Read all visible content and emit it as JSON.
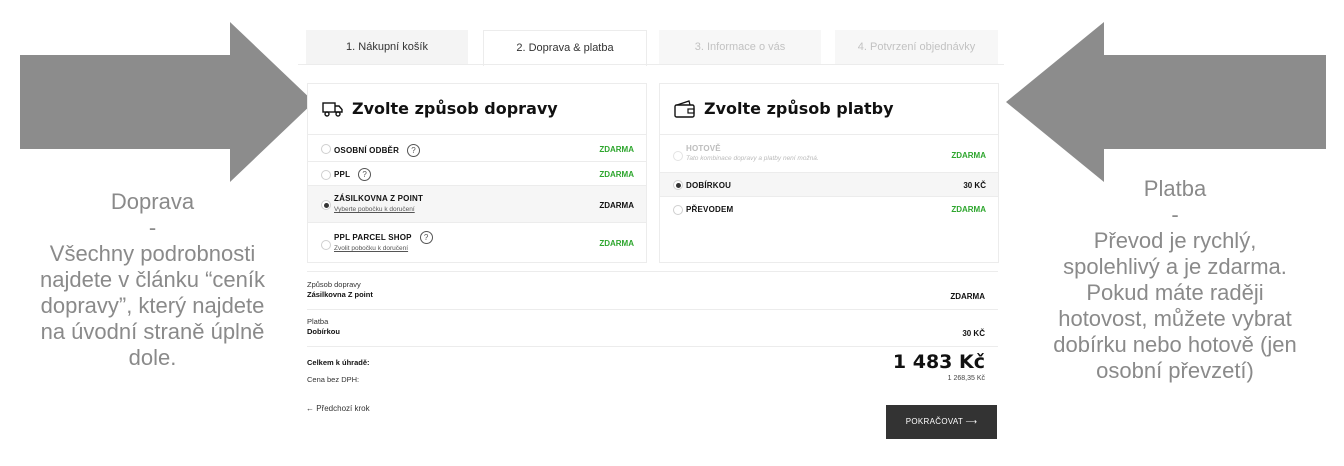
{
  "annotations": {
    "left": [
      "Doprava",
      "-",
      "Všechny podrobnosti",
      "najdete v článku “ceník",
      "dopravy”, který najdete",
      "na úvodní straně úplně",
      "dole."
    ],
    "right": [
      "Platba",
      "-",
      "Převod je rychlý,",
      "spolehlivý a je zdarma.",
      "Pokud máte raději",
      "hotovost, můžete vybrat",
      "dobírku nebo hotově (jen",
      "osobní převzetí)"
    ],
    "arrow_color": "#8c8c8c"
  },
  "tabs": [
    {
      "label": "1. Nákupní košík",
      "state": "normal"
    },
    {
      "label": "2. Doprava & platba",
      "state": "active"
    },
    {
      "label": "3. Informace o vás",
      "state": "disabled"
    },
    {
      "label": "4. Potvrzení objednávky",
      "state": "disabled"
    }
  ],
  "shipping": {
    "title": "Zvolte způsob dopravy",
    "icon": "truck-icon",
    "options": [
      {
        "label": "OSOBNÍ ODBĚR",
        "help": "?",
        "price": "ZDARMA",
        "selected": false
      },
      {
        "label": "PPL",
        "help": "?",
        "price": "ZDARMA",
        "selected": false
      },
      {
        "label": "ZÁSILKOVNA Z POINT",
        "link": "Vyberte pobočku k doručení",
        "price": "ZDARMA",
        "selected": true
      },
      {
        "label": "PPL PARCEL SHOP",
        "help": "?",
        "link": "Zvolit pobočku k doručení",
        "price": "ZDARMA",
        "selected": false
      }
    ]
  },
  "payment": {
    "title": "Zvolte způsob platby",
    "icon": "wallet-icon",
    "options": [
      {
        "label": "HOTOVĚ",
        "note": "Tato kombinace dopravy a platby není možná.",
        "price": "ZDARMA",
        "selected": false,
        "disabled": true
      },
      {
        "label": "DOBÍRKOU",
        "price": "30 KČ",
        "selected": true
      },
      {
        "label": "PŘEVODEM",
        "price": "ZDARMA",
        "selected": false
      }
    ]
  },
  "summary": {
    "shipping_label": "Způsob dopravy",
    "shipping_value": "Zásilkovna Z point",
    "shipping_price": "ZDARMA",
    "payment_label": "Platba",
    "payment_value": "Dobírkou",
    "payment_price": "30 KČ",
    "total_label": "Celkem k úhradě:",
    "total_value": "1 483 Kč",
    "net_label": "Cena bez DPH:",
    "net_value": "1 268,35 Kč"
  },
  "nav": {
    "back_label": "← Předchozí krok",
    "continue_label": "POKRAČOVAT ⟶"
  },
  "colors": {
    "green": "#2ea62e",
    "button": "#333333"
  }
}
